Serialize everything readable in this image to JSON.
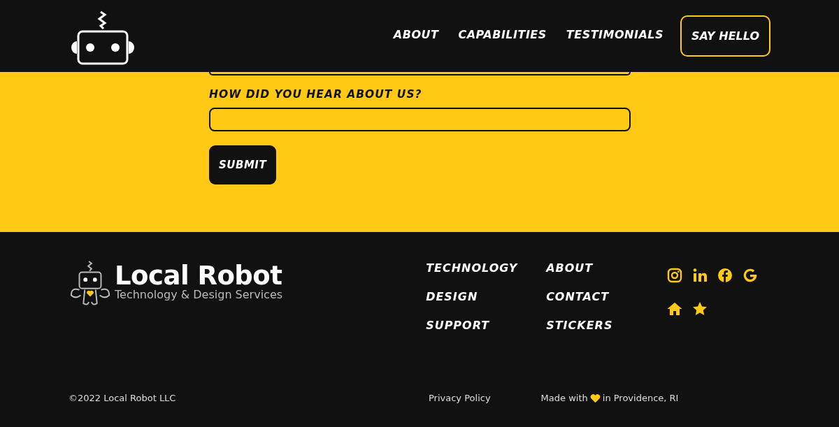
{
  "nav": {
    "links": [
      {
        "label": "ABOUT"
      },
      {
        "label": "CAPABILITIES"
      },
      {
        "label": "TESTIMONIALS"
      }
    ],
    "cta": "SAY HELLO"
  },
  "form": {
    "fields": [
      {
        "kind": "cut"
      },
      {
        "kind": "labeled",
        "label": "HOW DID YOU HEAR ABOUT US?"
      }
    ],
    "submit": "SUBMIT"
  },
  "footer": {
    "brand": {
      "name": "Local Robot",
      "tagline": "Technology & Design Services"
    },
    "link_columns": [
      [
        "TECHNOLOGY",
        "DESIGN",
        "SUPPORT"
      ],
      [
        "ABOUT",
        "CONTACT",
        "STICKERS"
      ]
    ],
    "social": [
      {
        "kind": "instagram"
      },
      {
        "kind": "linkedin"
      },
      {
        "kind": "facebook"
      },
      {
        "kind": "google"
      },
      {
        "kind": "home"
      },
      {
        "kind": "star"
      }
    ],
    "copyright": "©2022 Local Robot LLC",
    "privacy": "Privacy Policy",
    "made_with": {
      "before": "Made with",
      "after": "in Providence, RI"
    }
  }
}
